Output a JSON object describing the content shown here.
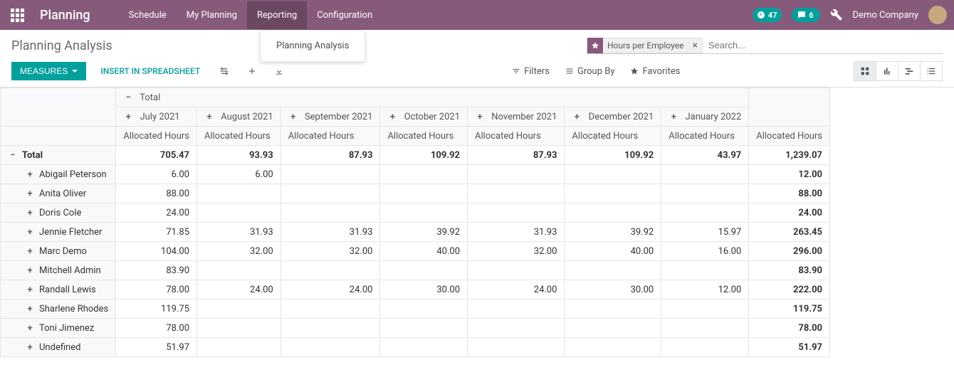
{
  "brand": "Planning",
  "nav": {
    "schedule": "Schedule",
    "my_planning": "My Planning",
    "reporting": "Reporting",
    "configuration": "Configuration"
  },
  "badges": {
    "clock": "47",
    "chat": "6"
  },
  "company": "Demo Company",
  "dropdown": {
    "planning_analysis": "Planning Analysis"
  },
  "page_title": "Planning Analysis",
  "facet": {
    "label": "Hours per Employee"
  },
  "search_placeholder": "Search...",
  "toolbar": {
    "measures": "MEASURES",
    "insert_spreadsheet": "INSERT IN SPREADSHEET",
    "filters": "Filters",
    "groupby": "Group By",
    "favorites": "Favorites"
  },
  "pivot": {
    "total_label": "Total",
    "alloc_label": "Allocated Hours",
    "months": [
      "July 2021",
      "August 2021",
      "September 2021",
      "October 2021",
      "November 2021",
      "December 2021",
      "January 2022"
    ],
    "total_row": [
      "705.47",
      "93.93",
      "87.93",
      "109.92",
      "87.93",
      "109.92",
      "43.97",
      "1,239.07"
    ],
    "rows": [
      {
        "name": "Abigail Peterson",
        "v": [
          "6.00",
          "6.00",
          "",
          "",
          "",
          "",
          "",
          "12.00"
        ]
      },
      {
        "name": "Anita Oliver",
        "v": [
          "88.00",
          "",
          "",
          "",
          "",
          "",
          "",
          "88.00"
        ]
      },
      {
        "name": "Doris Cole",
        "v": [
          "24.00",
          "",
          "",
          "",
          "",
          "",
          "",
          "24.00"
        ]
      },
      {
        "name": "Jennie Fletcher",
        "v": [
          "71.85",
          "31.93",
          "31.93",
          "39.92",
          "31.93",
          "39.92",
          "15.97",
          "263.45"
        ]
      },
      {
        "name": "Marc Demo",
        "v": [
          "104.00",
          "32.00",
          "32.00",
          "40.00",
          "32.00",
          "40.00",
          "16.00",
          "296.00"
        ]
      },
      {
        "name": "Mitchell Admin",
        "v": [
          "83.90",
          "",
          "",
          "",
          "",
          "",
          "",
          "83.90"
        ]
      },
      {
        "name": "Randall Lewis",
        "v": [
          "78.00",
          "24.00",
          "24.00",
          "30.00",
          "24.00",
          "30.00",
          "12.00",
          "222.00"
        ]
      },
      {
        "name": "Sharlene Rhodes",
        "v": [
          "119.75",
          "",
          "",
          "",
          "",
          "",
          "",
          "119.75"
        ]
      },
      {
        "name": "Toni Jimenez",
        "v": [
          "78.00",
          "",
          "",
          "",
          "",
          "",
          "",
          "78.00"
        ]
      },
      {
        "name": "Undefined",
        "v": [
          "51.97",
          "",
          "",
          "",
          "",
          "",
          "",
          "51.97"
        ]
      }
    ]
  }
}
